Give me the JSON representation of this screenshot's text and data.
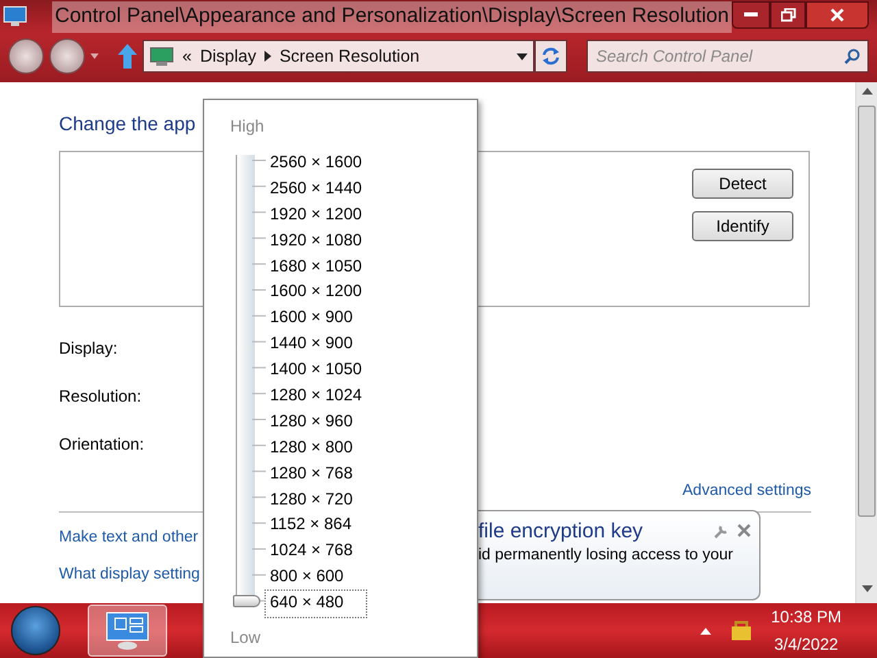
{
  "window": {
    "title": "Control Panel\\Appearance and Personalization\\Display\\Screen Resolution"
  },
  "address_bar": {
    "chevron": "«",
    "crumbs": [
      "Display",
      "Screen Resolution"
    ]
  },
  "search": {
    "placeholder": "Search Control Panel"
  },
  "heading": "Change the app",
  "monitor_buttons": [
    "Detect",
    "Identify"
  ],
  "settings_labels": [
    "Display:",
    "Resolution:",
    "Orientation:"
  ],
  "advanced_link": "Advanced settings",
  "links": [
    "Make text and other",
    "What display setting"
  ],
  "resolution_popup": {
    "high_label": "High",
    "low_label": "Low",
    "level": 0,
    "items": [
      {
        "label": "2560 × 1600",
        "selected": false
      },
      {
        "label": "2560 × 1440",
        "selected": false
      },
      {
        "label": "1920 × 1200",
        "selected": false
      },
      {
        "label": "1920 × 1080",
        "selected": false
      },
      {
        "label": "1680 × 1050",
        "selected": false
      },
      {
        "label": "1600 × 1200",
        "selected": false
      },
      {
        "label": "1600 × 900",
        "selected": false
      },
      {
        "label": "1440 × 900",
        "selected": false
      },
      {
        "label": "1400 × 1050",
        "selected": false
      },
      {
        "label": "1280 × 1024",
        "selected": false
      },
      {
        "label": "1280 × 960",
        "selected": false
      },
      {
        "label": "1280 × 800",
        "selected": false
      },
      {
        "label": "1280 × 768",
        "selected": false
      },
      {
        "label": "1280 × 720",
        "selected": false
      },
      {
        "label": "1152 × 864",
        "selected": false
      },
      {
        "label": "1024 × 768",
        "selected": false
      },
      {
        "label": "800 × 600",
        "selected": false
      },
      {
        "label": "640 × 480",
        "selected": true
      }
    ]
  },
  "notification": {
    "title": "file encryption key",
    "text": "id permanently losing access to your"
  },
  "taskbar": {
    "time": "10:38 PM",
    "date": "3/4/2022"
  }
}
